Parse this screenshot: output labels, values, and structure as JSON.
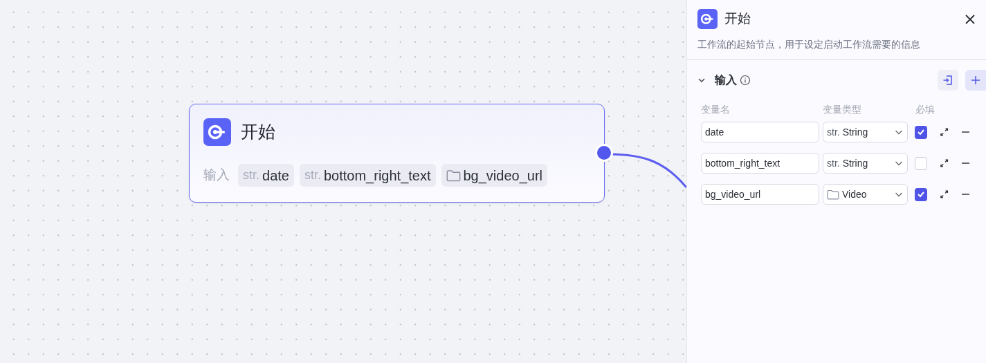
{
  "node": {
    "title": "开始",
    "inputs_label": "输入",
    "inputs": [
      {
        "kind": "str",
        "prefix": "str.",
        "name": "date"
      },
      {
        "kind": "str",
        "prefix": "str.",
        "name": "bottom_right_text"
      },
      {
        "kind": "file",
        "name": "bg_video_url"
      }
    ]
  },
  "panel": {
    "title": "开始",
    "description": "工作流的起始节点，用于设定启动工作流需要的信息",
    "section": {
      "title": "输入",
      "expanded": true,
      "columns": [
        "变量名",
        "变量类型",
        "必填"
      ],
      "rows": [
        {
          "name": "date",
          "kind": "str",
          "type_prefix": "str.",
          "type": "String",
          "required": true
        },
        {
          "name": "bottom_right_text",
          "kind": "str",
          "type_prefix": "str.",
          "type": "String",
          "required": false
        },
        {
          "name": "bg_video_url",
          "kind": "file",
          "type": "Video",
          "required": true
        }
      ]
    }
  }
}
